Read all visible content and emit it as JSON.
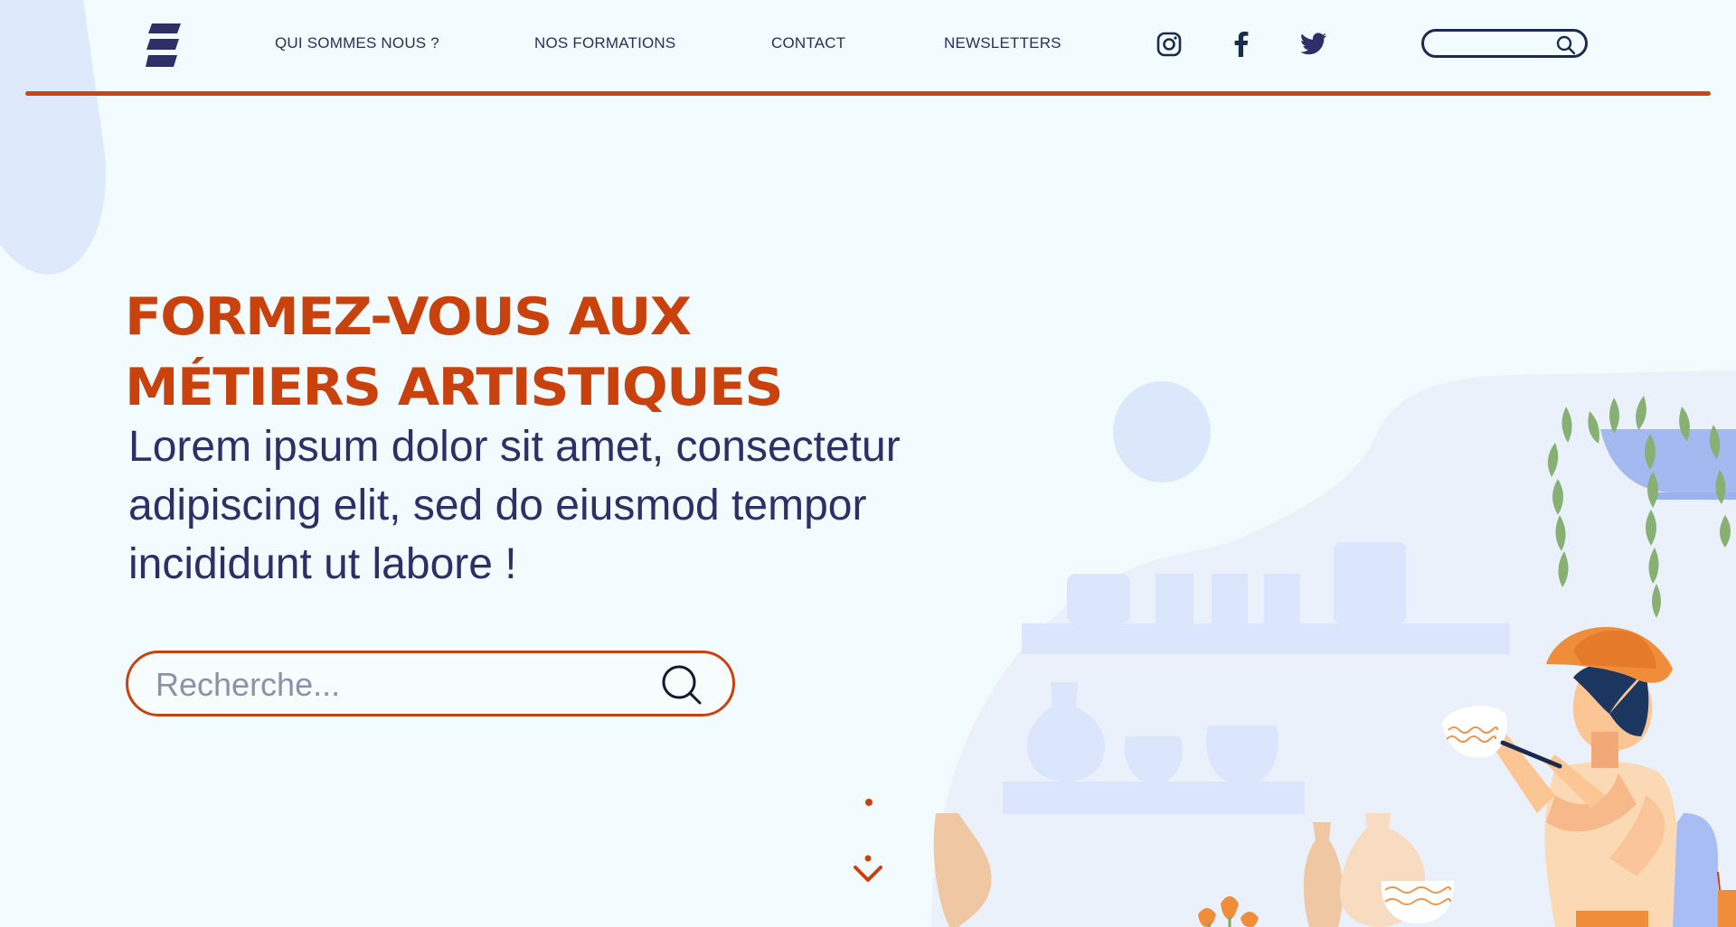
{
  "nav": {
    "items": [
      {
        "label": "QUI SOMMES NOUS ?"
      },
      {
        "label": "NOS FORMATIONS"
      },
      {
        "label": "CONTACT"
      },
      {
        "label": "NEWSLETTERS"
      }
    ],
    "social": [
      "instagram-icon",
      "facebook-icon",
      "twitter-icon"
    ],
    "search": {
      "value": "",
      "placeholder": ""
    }
  },
  "hero": {
    "title_line1": "FORMEZ-VOUS AUX",
    "title_line2": "MÉTIERS ARTISTIQUES",
    "text": "Lorem ipsum dolor sit amet, consectetur adipiscing elit, sed do eiusmod tempor incididunt ut labore !",
    "search": {
      "value": "",
      "placeholder": "Recherche..."
    }
  },
  "colors": {
    "accent": "#c9420e",
    "navy": "#2d2f66",
    "background": "#f2fbfd",
    "soft_blue": "#dbe7fb"
  }
}
